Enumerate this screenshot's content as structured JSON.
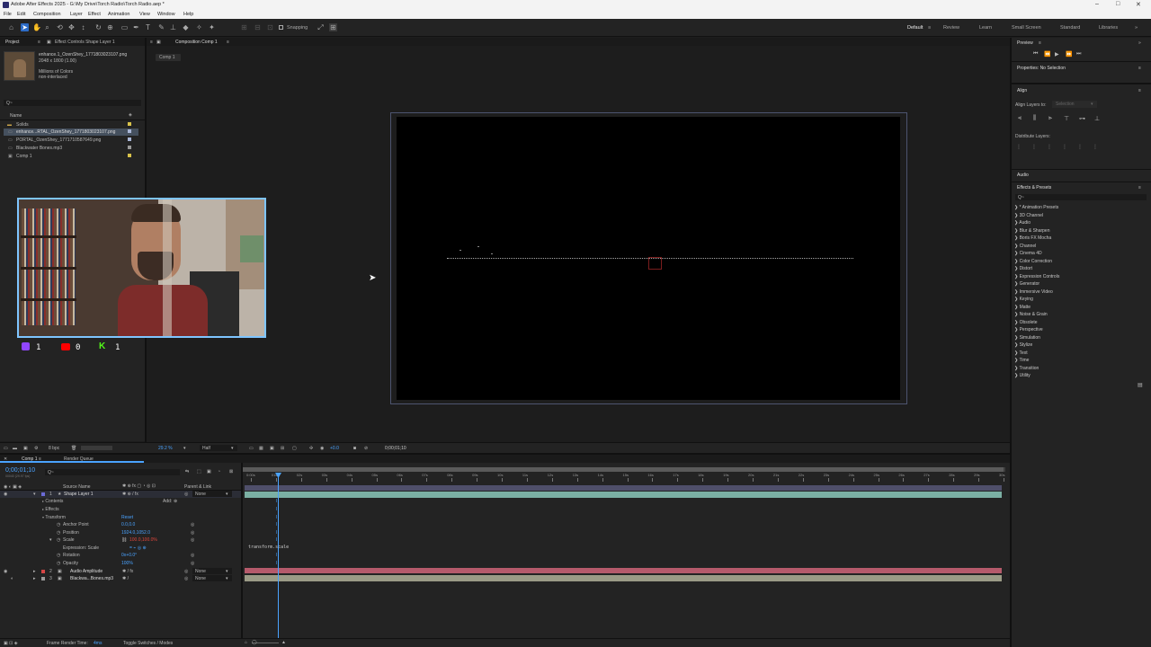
{
  "app": {
    "title": "Adobe After Effects 2025 - G:\\My Drive\\Torch Radio\\Torch Radio.aep *",
    "menu": [
      "File",
      "Edit",
      "Composition",
      "Layer",
      "Effect",
      "Animation",
      "View",
      "Window",
      "Help"
    ]
  },
  "toolbar": {
    "snapping_label": "Snapping",
    "workspaces": [
      "Default",
      "Review",
      "Learn",
      "Small Screen",
      "Standard",
      "Libraries"
    ]
  },
  "project": {
    "tab_project": "Project",
    "tab_effect_controls": "Effect Controls Shape Layer 1",
    "selected_name": "enhance.1_OzenShey_1771803023107.png",
    "selected_dims": "2048 x 1800 (1.00)",
    "selected_colors": "Millions of Colors",
    "selected_interlace": "non-interlaced",
    "search_placeholder": "Q~",
    "col_name": "Name",
    "items": [
      {
        "name": "Solids",
        "type": "folder",
        "selected": false
      },
      {
        "name": "enhance...RTAL_OzenShey_1771803023107.png",
        "type": "file",
        "selected": true
      },
      {
        "name": "PORTAL_OzenShey_1771710587649.png",
        "type": "file",
        "selected": false
      },
      {
        "name": "Blackwater Bones.mp3",
        "type": "file",
        "selected": false
      },
      {
        "name": "Comp 1",
        "type": "comp",
        "selected": false
      }
    ],
    "bpc": "8 bpc"
  },
  "composition": {
    "tab": "Composition Comp 1",
    "breadcrumb": "Comp 1",
    "zoom": "29.2 %",
    "quality": "Half",
    "timecode": "0;00;01;10",
    "exposure": "+0.0"
  },
  "webcam_stats": [
    {
      "platform": "twitch",
      "icon": "twitch-icon",
      "count": "1",
      "color": "#9146ff"
    },
    {
      "platform": "youtube",
      "icon": "youtube-icon",
      "count": "0",
      "color": "#ff0000"
    },
    {
      "platform": "kick",
      "icon": "kick-icon",
      "count": "1",
      "color": "#53fc18"
    }
  ],
  "right_panel": {
    "preview_tab": "Preview",
    "properties_tab": "Properties: No Selection",
    "align_title": "Align",
    "align_layers_to": "Align Layers to:",
    "align_selection": "Selection",
    "distribute_layers": "Distribute Layers:",
    "audio_title": "Audio",
    "effects_title": "Effects & Presets",
    "effects_search": "Q~",
    "effects": [
      "* Animation Presets",
      "3D Channel",
      "Audio",
      "Blur & Sharpen",
      "Boris FX Mocha",
      "Channel",
      "Cinema 4D",
      "Color Correction",
      "Distort",
      "Expression Controls",
      "Generator",
      "Immersive Video",
      "Keying",
      "Matte",
      "Noise & Grain",
      "Obsolete",
      "Perspective",
      "Simulation",
      "Stylize",
      "Text",
      "Time",
      "Transition",
      "Utility"
    ]
  },
  "timeline": {
    "tab_comp": "Comp 1",
    "tab_render": "Render Queue",
    "timecode": "0;00;01;10",
    "timecode_sub": "00040 (29.97 fps)",
    "search_placeholder": "Q~",
    "col_source": "Source Name",
    "col_parent": "Parent & Link",
    "ruler_marks": [
      "0:00s",
      "01s",
      "02s",
      "03s",
      "04s",
      "05s",
      "06s",
      "07s",
      "08s",
      "09s",
      "10s",
      "11s",
      "12s",
      "13s",
      "14s",
      "15s",
      "16s",
      "17s",
      "18s",
      "19s",
      "20s",
      "21s",
      "22s",
      "23s",
      "24s",
      "25s",
      "26s",
      "27s",
      "28s",
      "29s",
      "30s"
    ],
    "layers": [
      {
        "num": "1",
        "name": "Shape Layer 1",
        "parent": "None",
        "color": "#6b6bd6"
      },
      {
        "num": "2",
        "name": "Audio Amplitude",
        "parent": "None",
        "color": "#d64545"
      },
      {
        "num": "3",
        "name": "Blackwa...Bones.mp3",
        "parent": "None",
        "color": "#9a9a9a"
      }
    ],
    "props": {
      "contents": "Contents",
      "add": "Add:",
      "effects": "Effects",
      "transform": "Transform",
      "reset": "Reset",
      "anchor": "Anchor Point",
      "anchor_val": "0.0,0.0",
      "position": "Position",
      "position_val": "1924.0,1052.0",
      "scale": "Scale",
      "scale_val": "100.0,100.0%",
      "expr_scale": "Expression: Scale",
      "expr_text": "transform.scale",
      "rotation": "Rotation",
      "rotation_val": "0x+0.0°",
      "opacity": "Opacity",
      "opacity_val": "100%"
    },
    "footer_render_time": "Frame Render Time:",
    "footer_render_val": "4ms",
    "footer_toggle": "Toggle Switches / Modes"
  }
}
